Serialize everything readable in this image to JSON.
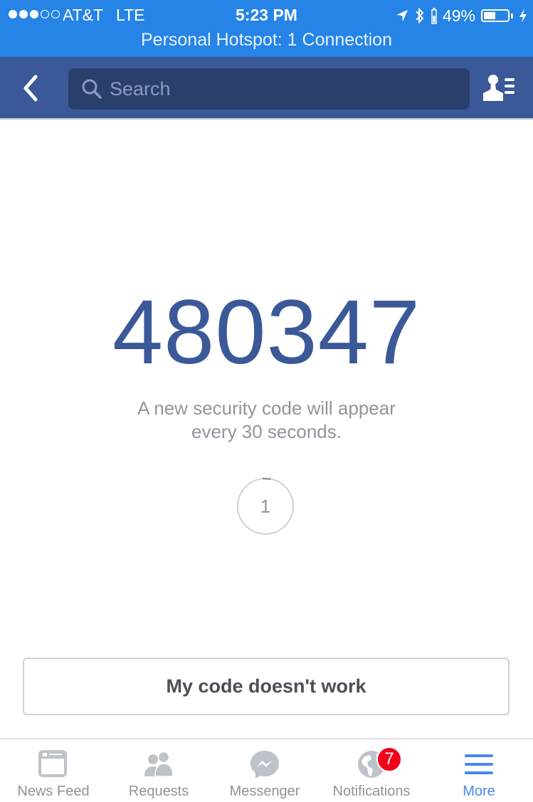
{
  "status_bar": {
    "signal_bars_filled": 3,
    "signal_bars_total": 5,
    "carrier": "AT&T",
    "network": "LTE",
    "time": "5:23 PM",
    "battery_percent_label": "49%",
    "battery_level": 0.49,
    "hotspot_text": "Personal Hotspot: 1 Connection",
    "icons": [
      "location-arrow-icon",
      "bluetooth-icon",
      "battery-icon",
      "charging-bolt-icon"
    ]
  },
  "nav": {
    "back_icon": "chevron-left-icon",
    "search_placeholder": "Search",
    "search_value": "",
    "profile_icon": "friend-list-icon"
  },
  "main": {
    "security_code": "480347",
    "hint_line1": "A new security code will appear",
    "hint_line2": "every 30 seconds.",
    "timer_value": "1",
    "timer_progress": 0.03,
    "code_help_button": "My code doesn't work"
  },
  "tab_bar": {
    "tabs": [
      {
        "label": "News Feed",
        "icon": "news-feed-icon",
        "active": false
      },
      {
        "label": "Requests",
        "icon": "friend-requests-icon",
        "active": false
      },
      {
        "label": "Messenger",
        "icon": "messenger-icon",
        "active": false
      },
      {
        "label": "Notifications",
        "icon": "globe-icon",
        "active": false,
        "badge": "7"
      },
      {
        "label": "More",
        "icon": "hamburger-menu-icon",
        "active": true
      }
    ]
  },
  "colors": {
    "status_bar": "#2684e6",
    "nav_bar": "#3b5998",
    "search_box": "#2b3f6d",
    "code_text": "#3b5998",
    "hint_text": "#90949c",
    "tab_inactive": "#bec2c9",
    "tab_active": "#4a86f0",
    "badge": "#f0001a"
  }
}
